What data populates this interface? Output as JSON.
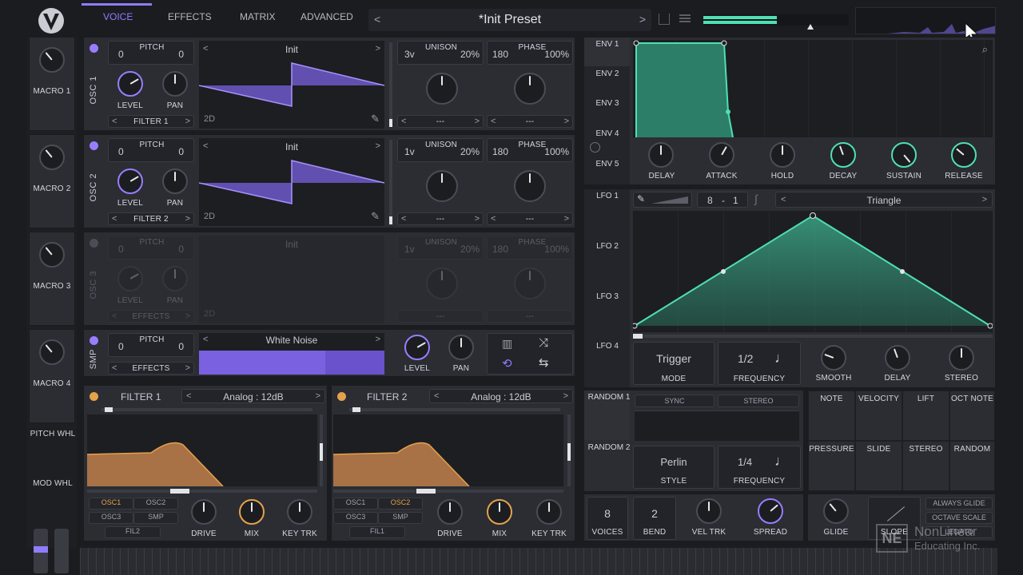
{
  "header": {
    "tabs": [
      {
        "label": "VOICE"
      },
      {
        "label": "EFFECTS"
      },
      {
        "label": "MATRIX"
      },
      {
        "label": "ADVANCED"
      }
    ],
    "preset_name": "*Init Preset"
  },
  "macros": [
    {
      "label": "MACRO 1"
    },
    {
      "label": "MACRO 2"
    },
    {
      "label": "MACRO 3"
    },
    {
      "label": "MACRO 4"
    }
  ],
  "wheels": {
    "pitch": "PITCH WHL",
    "mod": "MOD WHL"
  },
  "osc": [
    {
      "label": "OSC 1",
      "pitch_left": "0",
      "pitch_label": "PITCH",
      "pitch_right": "0",
      "level": "LEVEL",
      "pan": "PAN",
      "dest": "FILTER 1",
      "wave": "Init",
      "dim": "2D",
      "unison_voices": "3v",
      "unison_label": "UNISON",
      "unison_detune": "20%",
      "phase_value": "180",
      "phase_label": "PHASE",
      "phase_rand": "100%",
      "sel1": "---",
      "sel2": "---"
    },
    {
      "label": "OSC 2",
      "pitch_left": "0",
      "pitch_label": "PITCH",
      "pitch_right": "0",
      "level": "LEVEL",
      "pan": "PAN",
      "dest": "FILTER 2",
      "wave": "Init",
      "dim": "2D",
      "unison_voices": "1v",
      "unison_label": "UNISON",
      "unison_detune": "20%",
      "phase_value": "180",
      "phase_label": "PHASE",
      "phase_rand": "100%",
      "sel1": "---",
      "sel2": "---"
    },
    {
      "label": "OSC 3",
      "pitch_left": "0",
      "pitch_label": "PITCH",
      "pitch_right": "0",
      "level": "LEVEL",
      "pan": "PAN",
      "dest": "EFFECTS",
      "wave": "Init",
      "dim": "2D",
      "unison_voices": "1v",
      "unison_label": "UNISON",
      "unison_detune": "20%",
      "phase_value": "180",
      "phase_label": "PHASE",
      "phase_rand": "100%",
      "sel1": "---",
      "sel2": "---"
    }
  ],
  "smp": {
    "label": "SMP",
    "pitch_left": "0",
    "pitch_label": "PITCH",
    "pitch_right": "0",
    "dest": "EFFECTS",
    "sample": "White Noise",
    "level": "LEVEL",
    "pan": "PAN"
  },
  "filters": [
    {
      "title": "FILTER 1",
      "type": "Analog : 12dB",
      "src": [
        "OSC1",
        "OSC2",
        "OSC3",
        "SMP"
      ],
      "fil": "FIL2",
      "drive": "DRIVE",
      "mix": "MIX",
      "keytrk": "KEY TRK",
      "active_src": "OSC1"
    },
    {
      "title": "FILTER 2",
      "type": "Analog : 12dB",
      "src": [
        "OSC1",
        "OSC2",
        "OSC3",
        "SMP"
      ],
      "fil": "FIL1",
      "drive": "DRIVE",
      "mix": "MIX",
      "keytrk": "KEY TRK",
      "active_src": "OSC2"
    }
  ],
  "env": {
    "tabs": [
      "ENV 1",
      "ENV 2",
      "ENV 3",
      "ENV 4",
      "ENV 5"
    ],
    "knobs": [
      "DELAY",
      "ATTACK",
      "HOLD",
      "DECAY",
      "SUSTAIN",
      "RELEASE"
    ]
  },
  "lfo": {
    "tabs": [
      "LFO 1",
      "LFO 2",
      "LFO 3",
      "LFO 4"
    ],
    "grid_a": "8",
    "grid_sep": "-",
    "grid_b": "1",
    "shape": "Triangle",
    "mode_value": "Trigger",
    "mode_label": "MODE",
    "freq_value": "1/2",
    "freq_label": "FREQUENCY",
    "knobs": [
      "SMOOTH",
      "DELAY",
      "STEREO"
    ]
  },
  "random": {
    "tabs": [
      "RANDOM 1",
      "RANDOM 2"
    ],
    "sync": "SYNC",
    "stereo": "STEREO",
    "style_value": "Perlin",
    "style_label": "STYLE",
    "freq_value": "1/4",
    "freq_label": "FREQUENCY"
  },
  "mod_sources": [
    "NOTE",
    "VELOCITY",
    "LIFT",
    "OCT NOTE",
    "PRESSURE",
    "SLIDE",
    "STEREO",
    "RANDOM"
  ],
  "voice": {
    "voices_value": "8",
    "voices_label": "VOICES",
    "bend_value": "2",
    "bend_label": "BEND",
    "veltrk": "VEL TRK",
    "spread": "SPREAD",
    "glide": "GLIDE",
    "slope": "SLOPE",
    "always_glide": "ALWAYS GLIDE",
    "octave_scale": "OCTAVE SCALE",
    "legato": "LEGATO"
  },
  "watermark": {
    "line1": "NonLinear",
    "line2": "Educating Inc."
  },
  "colors": {
    "accent": "#8f7dff",
    "teal": "#4fe0b2",
    "orange": "#e5a24b"
  }
}
